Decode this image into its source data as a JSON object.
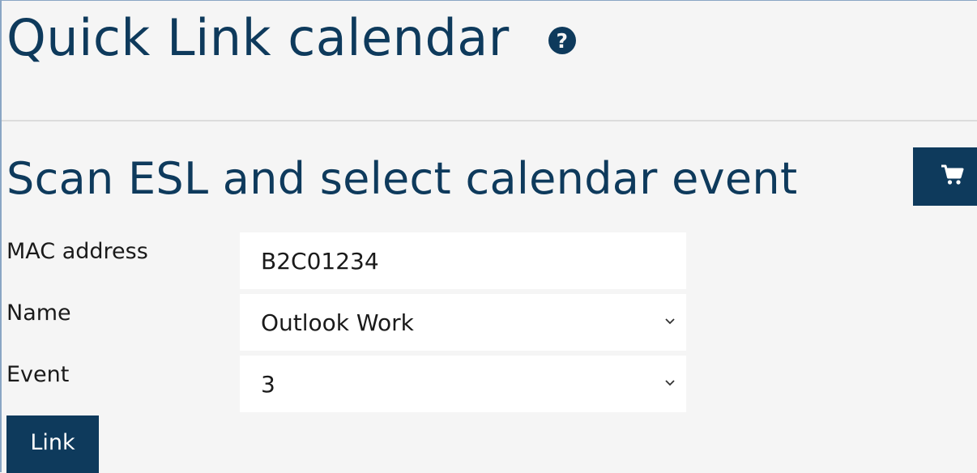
{
  "page": {
    "title": "Quick Link calendar",
    "help_icon": "question-circle-icon"
  },
  "section": {
    "title": "Scan ESL and select calendar event",
    "cart_icon": "shopping-cart-icon"
  },
  "form": {
    "mac_label": "MAC address",
    "mac_value": "B2C01234",
    "name_label": "Name",
    "name_selected": "Outlook Work",
    "event_label": "Event",
    "event_selected": "3",
    "link_label": "Link"
  },
  "colors": {
    "primary": "#0e3a5c",
    "background": "#f5f5f5",
    "field": "#ffffff"
  }
}
